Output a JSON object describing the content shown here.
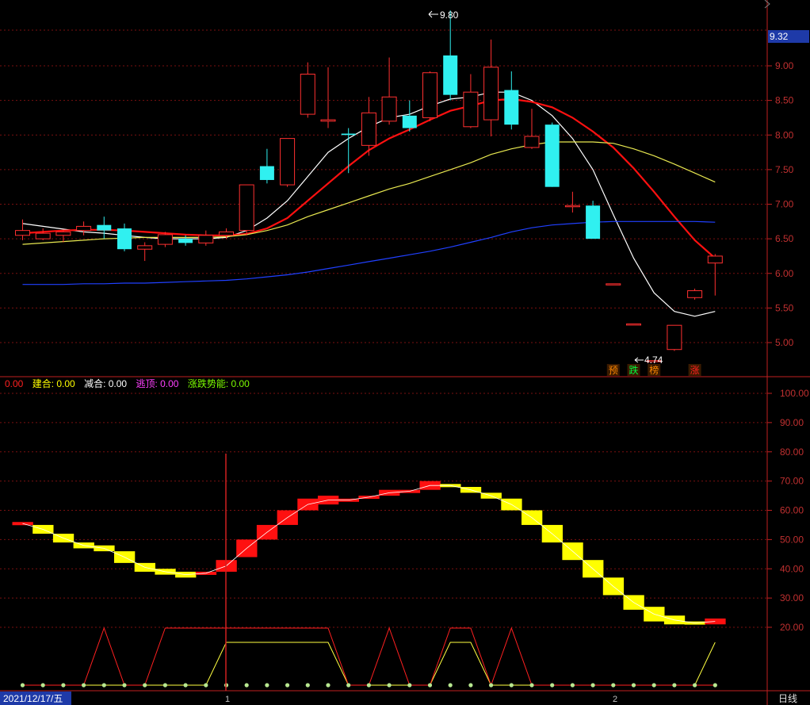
{
  "chart_data": [
    {
      "type": "candlestick",
      "panel": "price",
      "ylim": [
        4.55,
        10.0
      ],
      "y_ticks": [
        "9.00",
        "8.50",
        "8.00",
        "7.50",
        "7.00",
        "6.50",
        "6.00",
        "5.50",
        "5.00"
      ],
      "current_price_label": "9.32",
      "high_annotation": "9.80",
      "low_annotation": "4.74",
      "candles": [
        {
          "o": 6.55,
          "h": 6.78,
          "l": 6.48,
          "c": 6.62
        },
        {
          "o": 6.5,
          "h": 6.65,
          "l": 6.48,
          "c": 6.58
        },
        {
          "o": 6.55,
          "h": 6.62,
          "l": 6.45,
          "c": 6.6
        },
        {
          "o": 6.62,
          "h": 6.75,
          "l": 6.55,
          "c": 6.68
        },
        {
          "o": 6.7,
          "h": 6.82,
          "l": 6.5,
          "c": 6.62
        },
        {
          "o": 6.65,
          "h": 6.72,
          "l": 6.32,
          "c": 6.35
        },
        {
          "o": 6.35,
          "h": 6.45,
          "l": 6.18,
          "c": 6.4
        },
        {
          "o": 6.42,
          "h": 6.6,
          "l": 6.38,
          "c": 6.56
        },
        {
          "o": 6.5,
          "h": 6.55,
          "l": 6.4,
          "c": 6.44
        },
        {
          "o": 6.44,
          "h": 6.62,
          "l": 6.4,
          "c": 6.55
        },
        {
          "o": 6.55,
          "h": 6.65,
          "l": 6.5,
          "c": 6.6
        },
        {
          "o": 6.62,
          "h": 7.05,
          "l": 6.55,
          "c": 7.28
        },
        {
          "o": 7.55,
          "h": 7.8,
          "l": 7.3,
          "c": 7.35
        },
        {
          "o": 7.28,
          "h": 7.95,
          "l": 7.25,
          "c": 7.95
        },
        {
          "o": 8.3,
          "h": 9.05,
          "l": 8.25,
          "c": 8.88
        },
        {
          "o": 8.2,
          "h": 8.98,
          "l": 8.1,
          "c": 8.22
        },
        {
          "o": 8.02,
          "h": 8.1,
          "l": 7.45,
          "c": 8.0
        },
        {
          "o": 7.85,
          "h": 8.55,
          "l": 7.7,
          "c": 8.32
        },
        {
          "o": 8.2,
          "h": 9.12,
          "l": 8.15,
          "c": 8.55
        },
        {
          "o": 8.28,
          "h": 8.5,
          "l": 8.05,
          "c": 8.1
        },
        {
          "o": 8.25,
          "h": 8.92,
          "l": 8.2,
          "c": 8.9
        },
        {
          "o": 9.15,
          "h": 9.8,
          "l": 8.5,
          "c": 8.58
        },
        {
          "o": 8.12,
          "h": 8.88,
          "l": 8.1,
          "c": 8.62
        },
        {
          "o": 8.22,
          "h": 9.38,
          "l": 7.98,
          "c": 8.98
        },
        {
          "o": 8.65,
          "h": 8.92,
          "l": 8.08,
          "c": 8.15
        },
        {
          "o": 7.82,
          "h": 8.38,
          "l": 7.8,
          "c": 7.98
        },
        {
          "o": 8.15,
          "h": 8.18,
          "l": 7.25,
          "c": 7.25
        },
        {
          "o": 6.98,
          "h": 7.18,
          "l": 6.88,
          "c": 6.98
        },
        {
          "o": 6.98,
          "h": 7.05,
          "l": 6.5,
          "c": 6.5
        },
        {
          "o": 5.85,
          "h": 5.85,
          "l": 5.85,
          "c": 5.85
        },
        {
          "o": 5.27,
          "h": 5.27,
          "l": 5.27,
          "c": 5.27
        },
        {
          "o": 4.74,
          "h": 4.74,
          "l": 4.74,
          "c": 4.74
        },
        {
          "o": 4.9,
          "h": 5.25,
          "l": 4.88,
          "c": 5.25
        },
        {
          "o": 5.65,
          "h": 5.78,
          "l": 5.62,
          "c": 5.75
        },
        {
          "o": 6.15,
          "h": 6.28,
          "l": 5.68,
          "c": 6.25
        }
      ],
      "ma_lines": [
        {
          "color": "#ffffff",
          "values": [
            6.72,
            6.68,
            6.64,
            6.6,
            6.58,
            6.55,
            6.52,
            6.5,
            6.5,
            6.5,
            6.52,
            6.62,
            6.8,
            7.05,
            7.4,
            7.75,
            7.95,
            8.12,
            8.25,
            8.3,
            8.42,
            8.52,
            8.55,
            8.62,
            8.62,
            8.5,
            8.28,
            7.95,
            7.5,
            6.85,
            6.22,
            5.72,
            5.45,
            5.38,
            5.45
          ]
        },
        {
          "color": "#ff1010",
          "values": [
            6.58,
            6.6,
            6.62,
            6.63,
            6.63,
            6.62,
            6.6,
            6.58,
            6.56,
            6.55,
            6.55,
            6.57,
            6.65,
            6.8,
            7.05,
            7.3,
            7.55,
            7.78,
            7.95,
            8.08,
            8.22,
            8.35,
            8.42,
            8.5,
            8.52,
            8.48,
            8.4,
            8.25,
            8.05,
            7.82,
            7.52,
            7.18,
            6.82,
            6.48,
            6.22
          ]
        },
        {
          "color": "#e8e850",
          "values": [
            6.42,
            6.44,
            6.46,
            6.48,
            6.5,
            6.51,
            6.52,
            6.52,
            6.52,
            6.52,
            6.53,
            6.56,
            6.62,
            6.7,
            6.82,
            6.92,
            7.02,
            7.12,
            7.22,
            7.3,
            7.4,
            7.5,
            7.6,
            7.72,
            7.8,
            7.86,
            7.9,
            7.9,
            7.9,
            7.88,
            7.8,
            7.7,
            7.58,
            7.45,
            7.32
          ]
        },
        {
          "color": "#2040ff",
          "values": [
            5.84,
            5.84,
            5.84,
            5.85,
            5.85,
            5.86,
            5.86,
            5.87,
            5.88,
            5.89,
            5.9,
            5.92,
            5.95,
            5.98,
            6.02,
            6.07,
            6.12,
            6.17,
            6.22,
            6.27,
            6.32,
            6.38,
            6.45,
            6.52,
            6.6,
            6.66,
            6.7,
            6.72,
            6.74,
            6.75,
            6.75,
            6.75,
            6.75,
            6.75,
            6.74
          ]
        }
      ],
      "signal_markers": [
        {
          "index": 29,
          "text": "预",
          "color": "#ff8800"
        },
        {
          "index": 30,
          "text": "跌",
          "color": "#00ff40"
        },
        {
          "index": 31,
          "text": "榜",
          "color": "#ff8800"
        },
        {
          "index": 33,
          "text": "涨",
          "color": "#ff2020"
        }
      ]
    },
    {
      "type": "indicator",
      "panel": "oscillator",
      "ylim": [
        0,
        110
      ],
      "y_ticks": [
        "100.00",
        "90.00",
        "80.00",
        "70.00",
        "60.00",
        "50.00",
        "40.00",
        "30.00",
        "20.00"
      ],
      "legend": [
        {
          "label": "0.00",
          "color": "#ff2020"
        },
        {
          "label": "建合: 0.00",
          "color": "#ffff00"
        },
        {
          "label": "减合: 0.00",
          "color": "#ffffff"
        },
        {
          "label": "逃顶: 0.00",
          "color": "#ff40ff"
        },
        {
          "label": "涨跌势能: 0.00",
          "color": "#7cfc00"
        }
      ],
      "boxes": [
        {
          "o": 56,
          "c": 55,
          "color": "red"
        },
        {
          "o": 55,
          "c": 52,
          "color": "yellow"
        },
        {
          "o": 52,
          "c": 49,
          "color": "yellow"
        },
        {
          "o": 49,
          "c": 47,
          "color": "yellow"
        },
        {
          "o": 48,
          "c": 46,
          "color": "yellow"
        },
        {
          "o": 46,
          "c": 42,
          "color": "yellow"
        },
        {
          "o": 42,
          "c": 39,
          "color": "yellow"
        },
        {
          "o": 40,
          "c": 38,
          "color": "yellow"
        },
        {
          "o": 39,
          "c": 37,
          "color": "yellow"
        },
        {
          "o": 38,
          "c": 39,
          "color": "red"
        },
        {
          "o": 39,
          "c": 43,
          "color": "red"
        },
        {
          "o": 44,
          "c": 50,
          "color": "red"
        },
        {
          "o": 50,
          "c": 55,
          "color": "red"
        },
        {
          "o": 55,
          "c": 60,
          "color": "red"
        },
        {
          "o": 60,
          "c": 64,
          "color": "red"
        },
        {
          "o": 62,
          "c": 65,
          "color": "red"
        },
        {
          "o": 63,
          "c": 64,
          "color": "red"
        },
        {
          "o": 64,
          "c": 65,
          "color": "red"
        },
        {
          "o": 65,
          "c": 67,
          "color": "red"
        },
        {
          "o": 66,
          "c": 67,
          "color": "red"
        },
        {
          "o": 67,
          "c": 70,
          "color": "red"
        },
        {
          "o": 69,
          "c": 68,
          "color": "yellow"
        },
        {
          "o": 68,
          "c": 66,
          "color": "yellow"
        },
        {
          "o": 66,
          "c": 64,
          "color": "yellow"
        },
        {
          "o": 64,
          "c": 60,
          "color": "yellow"
        },
        {
          "o": 60,
          "c": 55,
          "color": "yellow"
        },
        {
          "o": 55,
          "c": 49,
          "color": "yellow"
        },
        {
          "o": 49,
          "c": 43,
          "color": "yellow"
        },
        {
          "o": 43,
          "c": 37,
          "color": "yellow"
        },
        {
          "o": 37,
          "c": 31,
          "color": "yellow"
        },
        {
          "o": 31,
          "c": 26,
          "color": "yellow"
        },
        {
          "o": 27,
          "c": 22,
          "color": "yellow"
        },
        {
          "o": 24,
          "c": 21,
          "color": "yellow"
        },
        {
          "o": 22,
          "c": 21,
          "color": "yellow"
        },
        {
          "o": 21,
          "c": 23,
          "color": "red"
        }
      ],
      "signal_red": [
        0,
        0,
        0,
        0,
        20,
        0,
        0,
        20,
        20,
        20,
        20,
        20,
        20,
        20,
        20,
        20,
        0,
        0,
        20,
        0,
        0,
        20,
        20,
        0,
        20,
        0,
        0,
        0,
        0,
        0,
        0,
        0,
        0,
        0,
        0
      ],
      "signal_yellow": [
        0,
        0,
        0,
        0,
        0,
        0,
        0,
        0,
        0,
        0,
        15,
        15,
        15,
        15,
        15,
        15,
        0,
        0,
        0,
        0,
        0,
        15,
        15,
        0,
        0,
        0,
        0,
        0,
        0,
        0,
        0,
        0,
        0,
        0,
        15
      ]
    }
  ],
  "x_axis": {
    "date_label": "2021/12/17/五",
    "markers": [
      "1",
      "2"
    ],
    "period_label": "日线"
  }
}
